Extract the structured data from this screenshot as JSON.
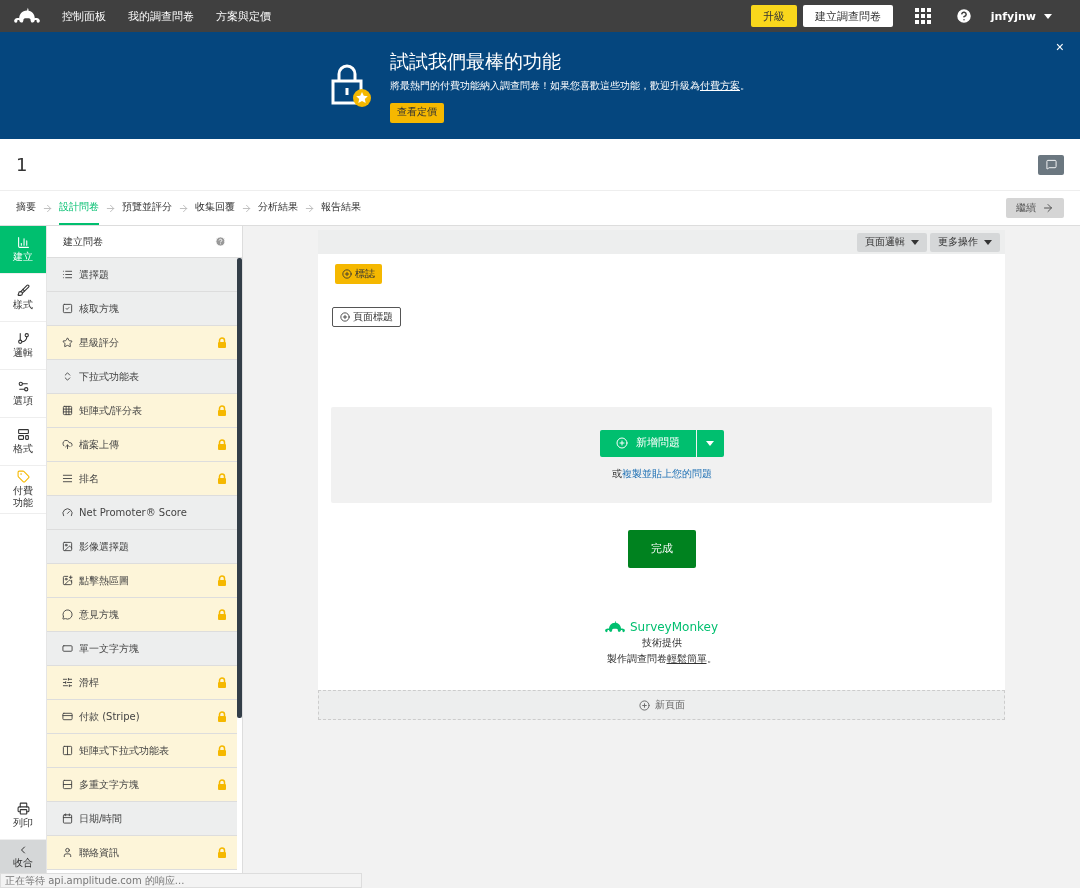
{
  "top_nav": {
    "links": [
      "控制面板",
      "我的調查問卷",
      "方案與定價"
    ],
    "upgrade": "升級",
    "create": "建立調查問卷",
    "user": "jnfyjnw"
  },
  "banner": {
    "title": "試試我們最棒的功能",
    "text": "將最熱門的付費功能納入調查問卷！如果您喜歡這些功能，歡迎升級為",
    "link": "付費方案",
    "after": "。",
    "button": "查看定價",
    "close": "×"
  },
  "survey_title": "1",
  "steps": [
    {
      "label": "摘要",
      "selected": false
    },
    {
      "label": "設計問卷",
      "selected": true
    },
    {
      "label": "預覽並評分",
      "selected": false
    },
    {
      "label": "收集回覆",
      "selected": false
    },
    {
      "label": "分析結果",
      "selected": false
    },
    {
      "label": "報告結果",
      "selected": false
    }
  ],
  "continue": "繼續",
  "rail": [
    {
      "label": "建立",
      "selected": true
    },
    {
      "label": "樣式",
      "selected": false
    },
    {
      "label": "邏輯",
      "selected": false
    },
    {
      "label": "選項",
      "selected": false
    },
    {
      "label": "格式",
      "selected": false
    },
    {
      "label": "付費功能",
      "selected": false
    }
  ],
  "rail_bottom": {
    "print": "列印",
    "collapse": "收合"
  },
  "panel": {
    "title": "建立問卷",
    "items": [
      {
        "label": "選擇題",
        "locked": false
      },
      {
        "label": "核取方塊",
        "locked": false
      },
      {
        "label": "星級評分",
        "locked": true
      },
      {
        "label": "下拉式功能表",
        "locked": false
      },
      {
        "label": "矩陣式/評分表",
        "locked": true
      },
      {
        "label": "檔案上傳",
        "locked": true
      },
      {
        "label": "排名",
        "locked": true
      },
      {
        "label": "Net Promoter® Score",
        "locked": false
      },
      {
        "label": "影像選擇題",
        "locked": false
      },
      {
        "label": "點擊熱區圖",
        "locked": true
      },
      {
        "label": "意見方塊",
        "locked": true
      },
      {
        "label": "單一文字方塊",
        "locked": false
      },
      {
        "label": "滑桿",
        "locked": true
      },
      {
        "label": "付款 (Stripe)",
        "locked": true
      },
      {
        "label": "矩陣式下拉式功能表",
        "locked": true
      },
      {
        "label": "多重文字方塊",
        "locked": true
      },
      {
        "label": "日期/時間",
        "locked": false
      },
      {
        "label": "聯絡資訊",
        "locked": true
      }
    ]
  },
  "canvas": {
    "page_logic": "頁面邏輯",
    "more_actions": "更多操作",
    "logo": "標誌",
    "page_title": "頁面標題",
    "add_question": "新增問題",
    "or": "或",
    "paste_link": "複製並貼上您的問題",
    "done": "完成",
    "brand": "SurveyMonkey",
    "powered": "技術提供",
    "tagline": "製作調查問卷",
    "tagline_link": "輕鬆簡單",
    "tagline_end": "。",
    "new_page": "新頁面"
  },
  "status_bar": "正在等待 api.amplitude.com 的响应..."
}
